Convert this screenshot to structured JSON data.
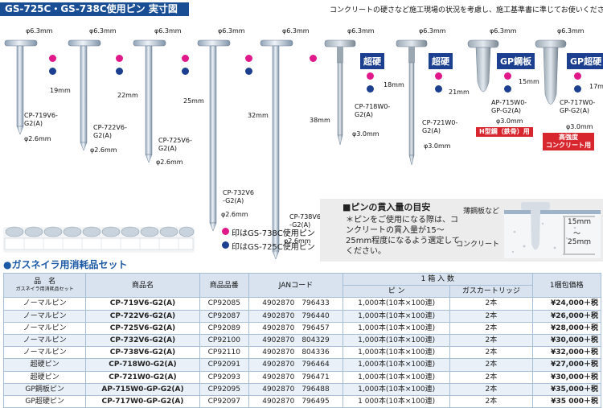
{
  "header": {
    "title": "GS-725C・GS-738C使用ピン 実寸図",
    "subtitle": "コンクリートの硬さなど施工現場の状況を考慮し、施工基準書に準じてお使いください。"
  },
  "pins": [
    {
      "id": "CP-719V6-G2(A)",
      "label": "CP-719V6-\nG2(A)",
      "head_dim": "φ6.3mm",
      "length": "19mm",
      "shank_dim": "φ2.6mm",
      "dots": [
        "magenta",
        "blue"
      ]
    },
    {
      "id": "CP-722V6-G2(A)",
      "label": "CP-722V6-\nG2(A)",
      "head_dim": "φ6.3mm",
      "length": "22mm",
      "shank_dim": "φ2.6mm",
      "dots": [
        "magenta",
        "blue"
      ]
    },
    {
      "id": "CP-725V6-G2(A)",
      "label": "CP-725V6-\nG2(A)",
      "head_dim": "φ6.3mm",
      "length": "25mm",
      "shank_dim": "φ2.6mm",
      "dots": [
        "magenta",
        "blue"
      ]
    },
    {
      "id": "CP-732V6-G2(A)",
      "label": "CP-732V6\n-G2(A)",
      "head_dim": "φ6.3mm",
      "length": "32mm",
      "shank_dim": "φ2.6mm",
      "dots": [
        "magenta",
        "blue"
      ]
    },
    {
      "id": "CP-738V6-G2(A)",
      "label": "CP-738V6\n-G2(A)",
      "head_dim": "φ6.3mm",
      "length": "38mm",
      "shank_dim": "φ2.6mm",
      "dots": [
        "magenta"
      ]
    },
    {
      "id": "CP-718W0-G2(A)",
      "label": "CP-718W0-\nG2(A)",
      "head_dim": "φ6.3mm",
      "length": "18mm",
      "shank_dim": "φ3.0mm",
      "dots": [
        "magenta",
        "blue"
      ],
      "tag": "超硬"
    },
    {
      "id": "CP-721W0-G2(A)",
      "label": "CP-721W0-\nG2(A)",
      "head_dim": "φ6.3mm",
      "length": "21mm",
      "shank_dim": "φ3.0mm",
      "dots": [
        "magenta",
        "blue"
      ],
      "tag": "超硬"
    },
    {
      "id": "AP-715W0-GP-G2(A)",
      "label": "AP-715W0-\nGP-G2(A)",
      "head_dim": "φ6.3mm",
      "length": "15mm",
      "shank_dim": "φ3.0mm",
      "dots": [
        "magenta",
        "blue"
      ],
      "tag": "GP鋼板",
      "red_tag": "H型鋼（鉄骨）用"
    },
    {
      "id": "CP-717W0-GP-G2(A)",
      "label": "CP-717W0-\nGP-G2(A)",
      "head_dim": "φ6.3mm",
      "length": "17mm",
      "shank_dim": "φ3.0mm",
      "dots": [
        "magenta",
        "blue"
      ],
      "tag": "GP超硬",
      "red_tag": "高強度\nコンクリート用"
    }
  ],
  "legend": {
    "magenta": "印はGS-738C使用ピン",
    "blue": "印はGS-725C使用ピン"
  },
  "guide": {
    "title": "■ピンの貫入量の目安",
    "text": "＊ピンをご使用になる際は、コンクリートの貫入量が15～25mm程度になるよう選定してください。",
    "label_sheet": "薄鋼板など",
    "label_concrete": "コンクリート",
    "depth_min": "15mm",
    "depth_max": "25mm",
    "tilde": "～"
  },
  "section_title": "●ガスネイラ用消耗品セット",
  "table": {
    "headers": {
      "name_top": "品　名",
      "name_sub": "ガスネイラ用消耗品セット",
      "product": "商品名",
      "code": "商品品番",
      "jan": "JANコード",
      "box": "1 箱 入 数",
      "pin": "ピ ン",
      "gas": "ガスカートリッジ",
      "price": "1梱包価格"
    },
    "rows": [
      {
        "name": "ノーマルピン",
        "product": "CP-719V6-G2(A)",
        "code": "CP92085",
        "jan": "4902870　796433",
        "pin": "1,000本(10本×100連)",
        "gas": "2本",
        "price": "¥24,000＋税"
      },
      {
        "name": "ノーマルピン",
        "product": "CP-722V6-G2(A)",
        "code": "CP92087",
        "jan": "4902870　796440",
        "pin": "1,000本(10本×100連)",
        "gas": "2本",
        "price": "¥26,000＋税"
      },
      {
        "name": "ノーマルピン",
        "product": "CP-725V6-G2(A)",
        "code": "CP92089",
        "jan": "4902870　796457",
        "pin": "1,000本(10本×100連)",
        "gas": "2本",
        "price": "¥28,000＋税"
      },
      {
        "name": "ノーマルピン",
        "product": "CP-732V6-G2(A)",
        "code": "CP92100",
        "jan": "4902870　804329",
        "pin": "1,000本(10本×100連)",
        "gas": "2本",
        "price": "¥30,000＋税"
      },
      {
        "name": "ノーマルピン",
        "product": "CP-738V6-G2(A)",
        "code": "CP92110",
        "jan": "4902870　804336",
        "pin": "1,000本(10本×100連)",
        "gas": "2本",
        "price": "¥32,000＋税"
      },
      {
        "name": "超硬ピン",
        "product": "CP-718W0-G2(A)",
        "code": "CP92091",
        "jan": "4902870　796464",
        "pin": "1,000本(10本×100連)",
        "gas": "2本",
        "price": "¥27,000＋税"
      },
      {
        "name": "超硬ピン",
        "product": "CP-721W0-G2(A)",
        "code": "CP92093",
        "jan": "4902870　796471",
        "pin": "1,000本(10本×100連)",
        "gas": "2本",
        "price": "¥30,000＋税"
      },
      {
        "name": "GP鋼板ピン",
        "product": "AP-715W0-GP-G2(A)",
        "code": "CP92095",
        "jan": "4902870　796488",
        "pin": "1,000本(10本×100連)",
        "gas": "2本",
        "price": "¥35,000＋税"
      },
      {
        "name": "GP超硬ピン",
        "product": "CP-717W0-GP-G2(A)",
        "code": "CP92097",
        "jan": "4902870　796495",
        "pin": "1 000本(10本×100連)",
        "gas": "2本",
        "price": "¥35 000＋税"
      }
    ]
  },
  "colors": {
    "brand": "#1a4e94",
    "magenta_dot": "#e0198b",
    "blue_dot": "#1c3f8f",
    "red_tag": "#d8262e",
    "table_header": "#d8e3ef"
  }
}
